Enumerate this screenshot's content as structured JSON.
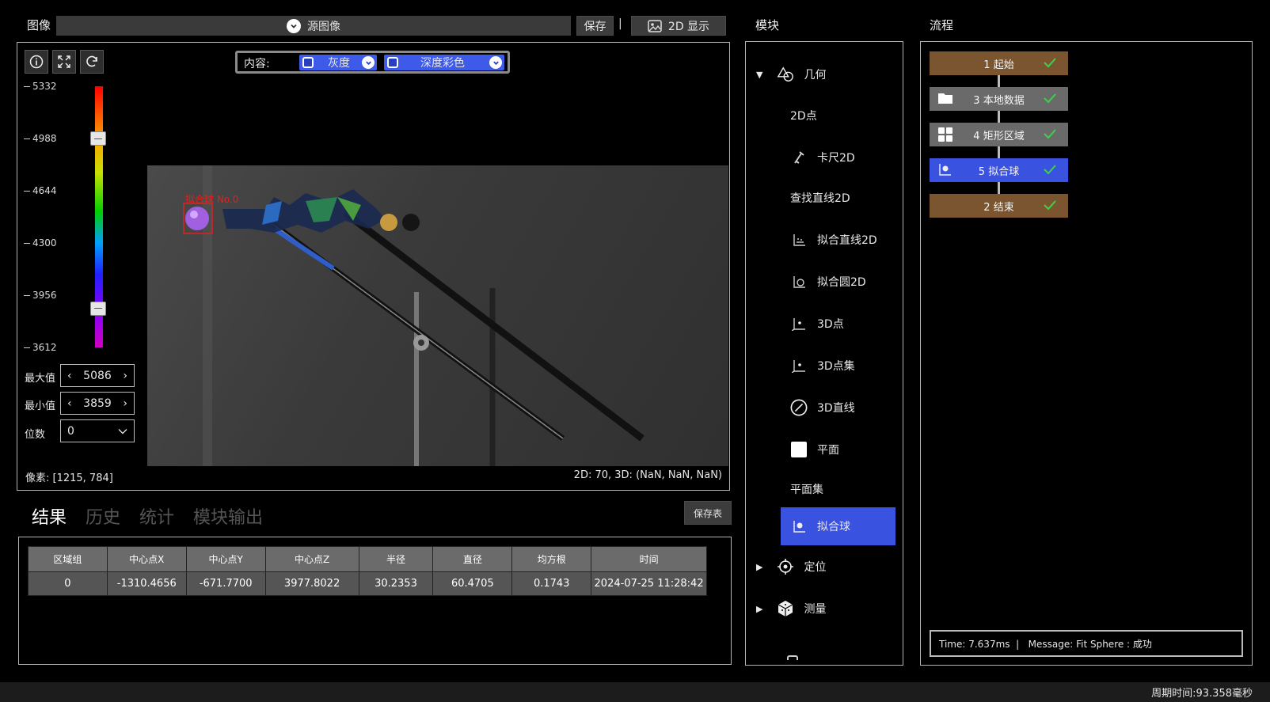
{
  "image_panel": {
    "title": "图像",
    "source_label": "源图像",
    "save_label": "保存",
    "separator": "|",
    "display_label": "2D 显示"
  },
  "content_bar": {
    "label": "内容:",
    "opt1": "灰度",
    "opt2": "深度彩色"
  },
  "colorbar": {
    "ticks": [
      "5332",
      "4988",
      "4644",
      "4300",
      "3956",
      "3612"
    ],
    "max_label": "最大值",
    "max_value": "5086",
    "min_label": "最小值",
    "min_value": "3859",
    "digits_label": "位数",
    "digits_value": "0",
    "upper_handle_fraction": 0.2,
    "lower_handle_fraction": 0.85
  },
  "viewport": {
    "pixel_readout": "像素: [1215, 784]",
    "value_readout": "2D: 70, 3D: (NaN, NaN, NaN)",
    "overlay_label": "拟合球 No.0",
    "overlay_color": "#e02020"
  },
  "results": {
    "tabs": [
      "结果",
      "历史",
      "统计",
      "模块输出"
    ],
    "save_table_label": "保存表",
    "columns": [
      "区域组",
      "中心点X",
      "中心点Y",
      "中心点Z",
      "半径",
      "直径",
      "均方根",
      "时间"
    ],
    "rows": [
      [
        "0",
        "-1310.4656",
        "-671.7700",
        "3977.8022",
        "30.2353",
        "60.4705",
        "0.1743",
        "2024-07-25 11:28:42"
      ]
    ]
  },
  "modules": {
    "title": "模块",
    "group_geometry": "几何",
    "items": [
      "2D点",
      "卡尺2D",
      "查找直线2D",
      "拟合直线2D",
      "拟合圆2D",
      "3D点",
      "3D点集",
      "3D直线",
      "平面",
      "平面集",
      "拟合球"
    ],
    "group_locate": "定位",
    "group_measure": "测量",
    "selected_color": "#3a52e0"
  },
  "flow": {
    "title": "流程",
    "nodes": [
      "1 起始",
      "3 本地数据",
      "4 矩形区域",
      "5 拟合球",
      "2 结束"
    ],
    "message": "Time: 7.637ms  |   Message: Fit Sphere : 成功"
  },
  "status_bar": {
    "cycle_time": "周期时间:93.358毫秒"
  }
}
